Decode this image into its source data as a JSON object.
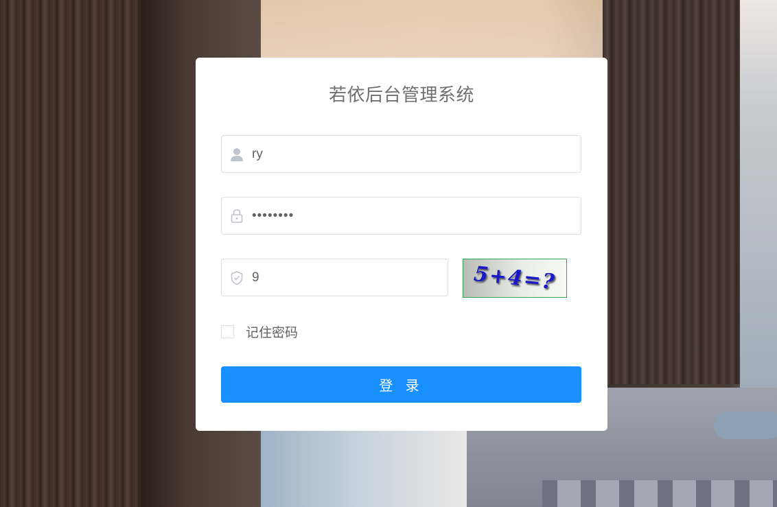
{
  "title": "若依后台管理系统",
  "form": {
    "username": {
      "value": "ry",
      "icon": "user-icon"
    },
    "password": {
      "value": "••••••••",
      "icon": "lock-icon"
    },
    "captcha_input": {
      "value": "9",
      "icon": "shield-icon"
    },
    "captcha_image_text": "5+4=?"
  },
  "remember": {
    "label": "记住密码",
    "checked": false
  },
  "login_button": {
    "label": "登 录"
  },
  "colors": {
    "primary": "#1890ff",
    "border": "#dcdfe6",
    "text": "#606266",
    "title": "#707070"
  }
}
